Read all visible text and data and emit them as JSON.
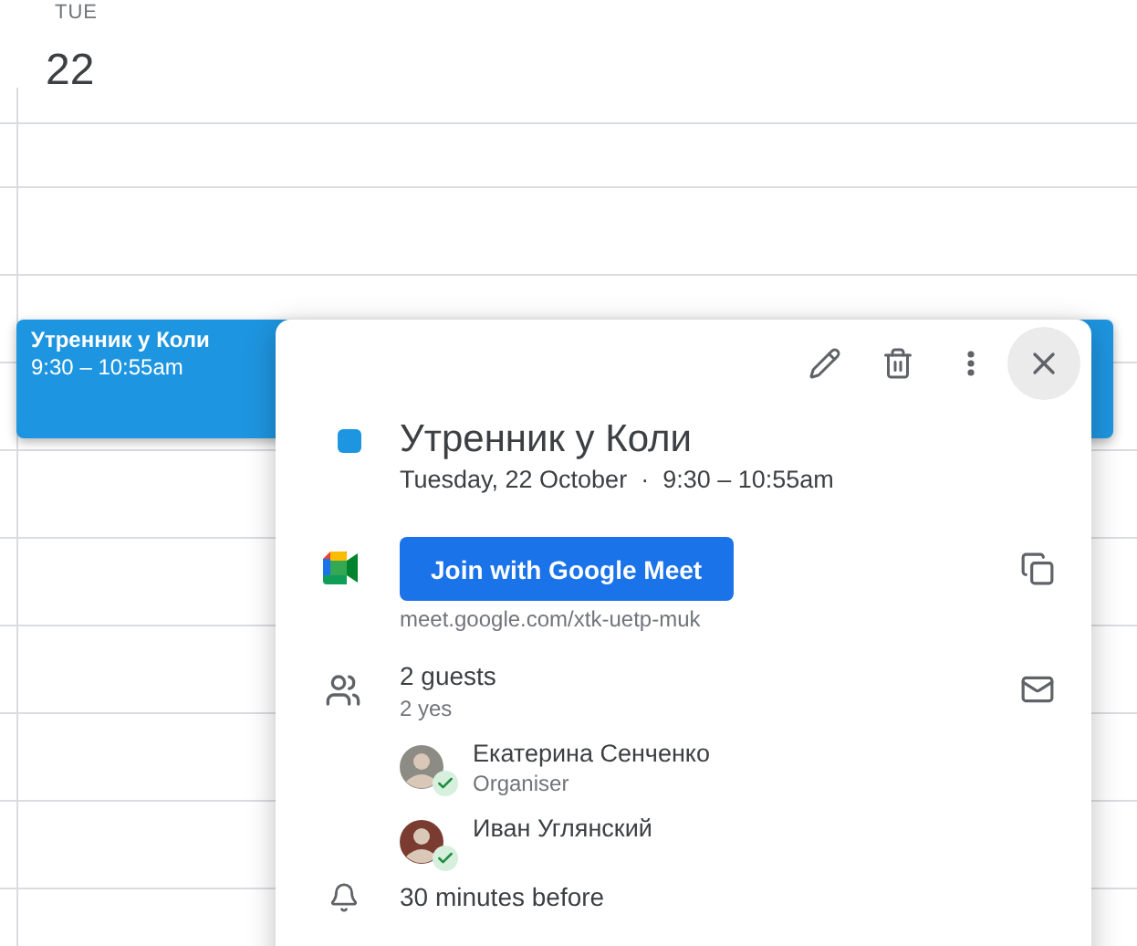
{
  "day": {
    "weekday": "TUE",
    "date": "22"
  },
  "event": {
    "title": "Утренник у Коли",
    "time": "9:30 – 10:55am"
  },
  "popup": {
    "title": "Утренник у Коли",
    "date_line": "Tuesday, 22 October  ·  9:30 – 10:55am",
    "meet_button": "Join with Google Meet",
    "meet_link": "meet.google.com/xtk-uetp-muk",
    "guests_count": "2 guests",
    "guests_summary": "2 yes",
    "guests": [
      {
        "name": "Екатерина Сенченко",
        "role": "Organiser",
        "accepted": true
      },
      {
        "name": "Иван Углянский",
        "accepted": true
      }
    ],
    "reminder": "30 minutes before"
  }
}
